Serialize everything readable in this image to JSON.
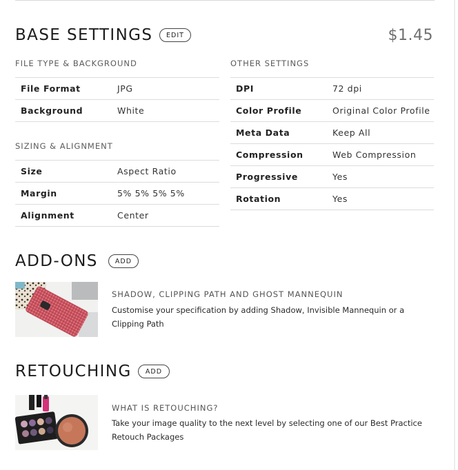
{
  "base": {
    "title": "BASE SETTINGS",
    "edit_label": "EDIT",
    "price": "$1.45"
  },
  "file_type": {
    "heading": "FILE TYPE & BACKGROUND",
    "rows": [
      {
        "label": "File Format",
        "value": "JPG"
      },
      {
        "label": "Background",
        "value": "White"
      }
    ]
  },
  "sizing": {
    "heading": "SIZING & ALIGNMENT",
    "rows": [
      {
        "label": "Size",
        "value": "Aspect Ratio"
      },
      {
        "label": "Margin",
        "value": "5% 5% 5% 5%"
      },
      {
        "label": "Alignment",
        "value": "Center"
      }
    ]
  },
  "other": {
    "heading": "OTHER SETTINGS",
    "rows": [
      {
        "label": "DPI",
        "value": "72 dpi"
      },
      {
        "label": "Color Profile",
        "value": "Original Color Profile"
      },
      {
        "label": "Meta Data",
        "value": "Keep All"
      },
      {
        "label": "Compression",
        "value": "Web Compression"
      },
      {
        "label": "Progressive",
        "value": "Yes"
      },
      {
        "label": "Rotation",
        "value": "Yes"
      }
    ]
  },
  "addons": {
    "title": "ADD-ONS",
    "add_label": "ADD",
    "item_title": "SHADOW, CLIPPING PATH AND GHOST MANNEQUIN",
    "item_desc": "Customise your specification by adding Shadow, Invisible Mannequin or a Clipping Path"
  },
  "retouching": {
    "title": "RETOUCHING",
    "add_label": "ADD",
    "item_title": "WHAT IS RETOUCHING?",
    "item_desc": "Take your image quality to the next level by selecting one of our Best Practice Retouch Packages"
  }
}
